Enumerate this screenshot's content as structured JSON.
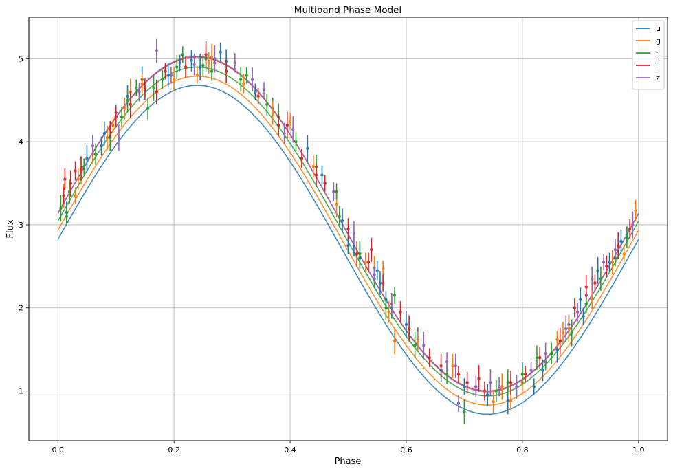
{
  "chart_data": {
    "type": "scatter",
    "title": "Multiband Phase Model",
    "xlabel": "Phase",
    "ylabel": "Flux",
    "xlim": [
      -0.05,
      1.05
    ],
    "ylim": [
      0.4,
      5.5
    ],
    "xticks": [
      0.0,
      0.2,
      0.4,
      0.6,
      0.8,
      1.0
    ],
    "xtick_labels": [
      "0.0",
      "0.2",
      "0.4",
      "0.6",
      "0.8",
      "1.0"
    ],
    "yticks": [
      1,
      2,
      3,
      4,
      5
    ],
    "ytick_labels": [
      "1",
      "2",
      "3",
      "4",
      "5"
    ],
    "grid": true,
    "legend": {
      "position": "top-right"
    },
    "model": {
      "form": "offset + amplitude * sin(2*pi*(phase - 0.74) + pi/2) model curve",
      "peak_phase": 0.24
    },
    "series": [
      {
        "name": "u",
        "color": "#1f77b4",
        "model_curve": {
          "mean": 2.7,
          "amplitude": 1.98
        },
        "points": [
          [
            0.015,
            3.15
          ],
          [
            0.05,
            3.8
          ],
          [
            0.075,
            3.95
          ],
          [
            0.08,
            4.1
          ],
          [
            0.1,
            4.35
          ],
          [
            0.12,
            4.55
          ],
          [
            0.145,
            4.75
          ],
          [
            0.15,
            4.62
          ],
          [
            0.19,
            4.8
          ],
          [
            0.21,
            4.95
          ],
          [
            0.23,
            4.98
          ],
          [
            0.245,
            4.9
          ],
          [
            0.28,
            5.08
          ],
          [
            0.29,
            4.97
          ],
          [
            0.34,
            4.6
          ],
          [
            0.37,
            4.4
          ],
          [
            0.43,
            3.92
          ],
          [
            0.455,
            3.6
          ],
          [
            0.49,
            3.05
          ],
          [
            0.5,
            2.75
          ],
          [
            0.51,
            2.75
          ],
          [
            0.52,
            2.6
          ],
          [
            0.55,
            2.45
          ],
          [
            0.555,
            2.3
          ],
          [
            0.565,
            2.1
          ],
          [
            0.575,
            2.0
          ],
          [
            0.6,
            1.8
          ],
          [
            0.62,
            1.65
          ],
          [
            0.66,
            1.25
          ],
          [
            0.7,
            1.05
          ],
          [
            0.74,
            0.95
          ],
          [
            0.775,
            0.88
          ],
          [
            0.79,
            1.05
          ],
          [
            0.8,
            1.2
          ],
          [
            0.82,
            1.05
          ],
          [
            0.835,
            1.25
          ],
          [
            0.86,
            1.5
          ],
          [
            0.88,
            1.8
          ],
          [
            0.9,
            2.1
          ],
          [
            0.905,
            1.9
          ],
          [
            0.91,
            2.15
          ],
          [
            0.93,
            2.45
          ],
          [
            0.95,
            2.55
          ],
          [
            0.97,
            2.8
          ],
          [
            0.98,
            2.88
          ]
        ]
      },
      {
        "name": "g",
        "color": "#ff7f0e",
        "model_curve": {
          "mean": 2.81,
          "amplitude": 1.98
        },
        "points": [
          [
            0.01,
            3.35
          ],
          [
            0.03,
            3.35
          ],
          [
            0.035,
            3.55
          ],
          [
            0.04,
            3.65
          ],
          [
            0.06,
            3.85
          ],
          [
            0.085,
            4.05
          ],
          [
            0.095,
            4.2
          ],
          [
            0.115,
            4.4
          ],
          [
            0.125,
            4.6
          ],
          [
            0.145,
            4.7
          ],
          [
            0.2,
            4.75
          ],
          [
            0.24,
            4.8
          ],
          [
            0.26,
            4.95
          ],
          [
            0.265,
            5.02
          ],
          [
            0.32,
            4.7
          ],
          [
            0.37,
            4.35
          ],
          [
            0.4,
            4.25
          ],
          [
            0.44,
            3.7
          ],
          [
            0.48,
            3.25
          ],
          [
            0.53,
            2.55
          ],
          [
            0.545,
            2.48
          ],
          [
            0.56,
            2.47
          ],
          [
            0.57,
            1.95
          ],
          [
            0.58,
            1.6
          ],
          [
            0.62,
            1.6
          ],
          [
            0.68,
            1.3
          ],
          [
            0.72,
            1.05
          ],
          [
            0.75,
            0.87
          ],
          [
            0.765,
            1.05
          ],
          [
            0.78,
            0.88
          ],
          [
            0.8,
            1.1
          ],
          [
            0.86,
            1.62
          ],
          [
            0.87,
            1.7
          ],
          [
            0.88,
            1.75
          ],
          [
            0.92,
            2.1
          ],
          [
            0.955,
            2.55
          ],
          [
            0.975,
            2.65
          ],
          [
            0.995,
            3.17
          ]
        ]
      },
      {
        "name": "r",
        "color": "#2ca02c",
        "model_curve": {
          "mean": 2.92,
          "amplitude": 1.98
        },
        "points": [
          [
            0.005,
            3.2
          ],
          [
            0.015,
            3.1
          ],
          [
            0.02,
            3.4
          ],
          [
            0.045,
            3.7
          ],
          [
            0.065,
            3.85
          ],
          [
            0.09,
            4.05
          ],
          [
            0.11,
            4.3
          ],
          [
            0.12,
            4.5
          ],
          [
            0.135,
            4.65
          ],
          [
            0.155,
            4.4
          ],
          [
            0.165,
            4.65
          ],
          [
            0.18,
            4.75
          ],
          [
            0.205,
            4.9
          ],
          [
            0.215,
            5.05
          ],
          [
            0.25,
            4.92
          ],
          [
            0.255,
            5.0
          ],
          [
            0.265,
            4.85
          ],
          [
            0.315,
            4.75
          ],
          [
            0.325,
            4.8
          ],
          [
            0.36,
            4.45
          ],
          [
            0.38,
            4.3
          ],
          [
            0.41,
            4.0
          ],
          [
            0.445,
            3.7
          ],
          [
            0.48,
            3.4
          ],
          [
            0.485,
            3.1
          ],
          [
            0.52,
            2.65
          ],
          [
            0.545,
            2.35
          ],
          [
            0.565,
            2.0
          ],
          [
            0.58,
            2.15
          ],
          [
            0.605,
            1.75
          ],
          [
            0.615,
            1.55
          ],
          [
            0.67,
            1.2
          ],
          [
            0.7,
            0.75
          ],
          [
            0.72,
            1.05
          ],
          [
            0.755,
            1.0
          ],
          [
            0.775,
            1.1
          ],
          [
            0.8,
            1.2
          ],
          [
            0.825,
            1.4
          ],
          [
            0.84,
            1.35
          ],
          [
            0.85,
            1.45
          ],
          [
            0.885,
            1.7
          ],
          [
            0.91,
            2.05
          ],
          [
            0.935,
            2.35
          ],
          [
            0.96,
            2.6
          ],
          [
            0.98,
            2.85
          ]
        ]
      },
      {
        "name": "i",
        "color": "#d62728",
        "model_curve": {
          "mean": 3.01,
          "amplitude": 2.01
        },
        "points": [
          [
            0.01,
            3.35
          ],
          [
            0.012,
            3.55
          ],
          [
            0.022,
            3.5
          ],
          [
            0.03,
            3.65
          ],
          [
            0.04,
            3.68
          ],
          [
            0.09,
            4.15
          ],
          [
            0.1,
            4.3
          ],
          [
            0.125,
            4.45
          ],
          [
            0.15,
            4.65
          ],
          [
            0.17,
            4.6
          ],
          [
            0.185,
            4.85
          ],
          [
            0.22,
            4.9
          ],
          [
            0.255,
            5.05
          ],
          [
            0.27,
            4.95
          ],
          [
            0.29,
            4.85
          ],
          [
            0.345,
            4.55
          ],
          [
            0.38,
            4.2
          ],
          [
            0.395,
            4.2
          ],
          [
            0.42,
            3.8
          ],
          [
            0.445,
            3.6
          ],
          [
            0.46,
            3.5
          ],
          [
            0.5,
            2.95
          ],
          [
            0.515,
            2.65
          ],
          [
            0.535,
            2.55
          ],
          [
            0.54,
            2.7
          ],
          [
            0.56,
            2.3
          ],
          [
            0.59,
            1.95
          ],
          [
            0.605,
            1.75
          ],
          [
            0.64,
            1.4
          ],
          [
            0.66,
            1.3
          ],
          [
            0.69,
            1.2
          ],
          [
            0.705,
            1.1
          ],
          [
            0.725,
            1.15
          ],
          [
            0.735,
            1.0
          ],
          [
            0.78,
            1.1
          ],
          [
            0.805,
            1.2
          ],
          [
            0.83,
            1.4
          ],
          [
            0.865,
            1.6
          ],
          [
            0.89,
            2.0
          ],
          [
            0.91,
            2.25
          ],
          [
            0.925,
            2.3
          ],
          [
            0.945,
            2.5
          ],
          [
            0.965,
            2.75
          ],
          [
            0.985,
            2.95
          ]
        ]
      },
      {
        "name": "z",
        "color": "#9467bd",
        "model_curve": {
          "mean": 3.01,
          "amplitude": 2.02
        },
        "points": [
          [
            0.06,
            3.95
          ],
          [
            0.105,
            4.05
          ],
          [
            0.14,
            4.6
          ],
          [
            0.17,
            5.1
          ],
          [
            0.195,
            4.8
          ],
          [
            0.235,
            4.93
          ],
          [
            0.27,
            5.0
          ],
          [
            0.305,
            4.95
          ],
          [
            0.335,
            4.75
          ],
          [
            0.355,
            4.62
          ],
          [
            0.39,
            4.1
          ],
          [
            0.405,
            4.15
          ],
          [
            0.475,
            3.4
          ],
          [
            0.51,
            2.9
          ],
          [
            0.545,
            2.4
          ],
          [
            0.575,
            2.05
          ],
          [
            0.63,
            1.55
          ],
          [
            0.67,
            1.35
          ],
          [
            0.685,
            1.3
          ],
          [
            0.69,
            0.85
          ],
          [
            0.72,
            1.05
          ],
          [
            0.745,
            1.1
          ],
          [
            0.76,
            1.05
          ],
          [
            0.79,
            1.05
          ],
          [
            0.815,
            1.25
          ],
          [
            0.84,
            1.45
          ],
          [
            0.875,
            1.75
          ],
          [
            0.895,
            1.95
          ],
          [
            0.92,
            2.35
          ],
          [
            0.94,
            2.55
          ],
          [
            0.96,
            2.7
          ],
          [
            0.99,
            3.0
          ]
        ]
      }
    ]
  }
}
